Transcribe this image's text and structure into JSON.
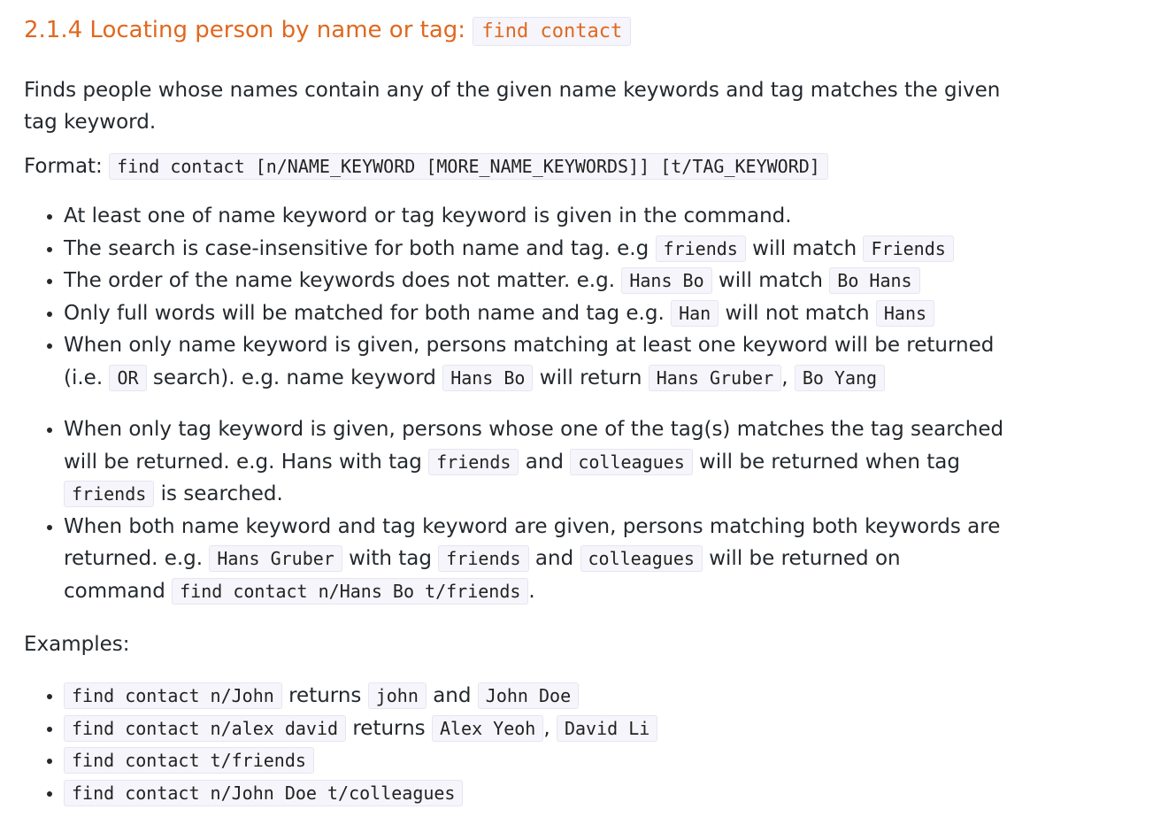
{
  "heading": {
    "text": "2.1.4 Locating person by name or tag: ",
    "code": "find contact"
  },
  "intro": "Finds people whose names contain any of the given name keywords and tag matches the given tag keyword.",
  "format": {
    "label": "Format: ",
    "code": "find contact [n/NAME_KEYWORD [MORE_NAME_KEYWORDS]] [t/TAG_KEYWORD]"
  },
  "notes_a": [
    {
      "t1": "At least one of name keyword or tag keyword is given in the command."
    },
    {
      "t1": "The search is case-insensitive for both name and tag. e.g ",
      "c1": "friends",
      "t2": " will match ",
      "c2": "Friends"
    },
    {
      "t1": "The order of the name keywords does not matter. e.g. ",
      "c1": "Hans Bo",
      "t2": " will match ",
      "c2": "Bo Hans"
    },
    {
      "t1": "Only full words will be matched for both name and tag e.g. ",
      "c1": "Han",
      "t2": " will not match ",
      "c2": "Hans"
    },
    {
      "t1": "When only name keyword is given, persons matching at least one keyword will be returned (i.e. ",
      "c1": "OR",
      "t2": " search). e.g. name keyword ",
      "c2": "Hans Bo",
      "t3": " will return ",
      "c3": "Hans Gruber",
      "t4": ", ",
      "c4": "Bo Yang"
    }
  ],
  "notes_b": [
    {
      "t1": "When only tag keyword is given, persons whose one of the tag(s) matches the tag searched will be returned. e.g. Hans with tag ",
      "c1": "friends",
      "t2": " and ",
      "c2": "colleagues",
      "t3": " will be returned when tag ",
      "c3": "friends",
      "t4": " is searched."
    },
    {
      "t1": "When both name keyword and tag keyword are given, persons matching both keywords are returned. e.g. ",
      "c1": "Hans Gruber",
      "t2": " with tag ",
      "c2": "friends",
      "t3": " and ",
      "c3": "colleagues",
      "t4": " will be returned on command ",
      "c4": "find contact n/Hans Bo t/friends",
      "t5": "."
    }
  ],
  "examples_label": "Examples:",
  "examples": [
    {
      "c1": "find contact n/John",
      "t1": " returns ",
      "c2": "john",
      "t2": " and ",
      "c3": "John Doe"
    },
    {
      "c1": "find contact n/alex david",
      "t1": " returns ",
      "c2": "Alex Yeoh",
      "t2": ", ",
      "c3": "David Li"
    },
    {
      "c1": "find contact t/friends"
    },
    {
      "c1": "find contact n/John Doe t/colleagues"
    }
  ]
}
